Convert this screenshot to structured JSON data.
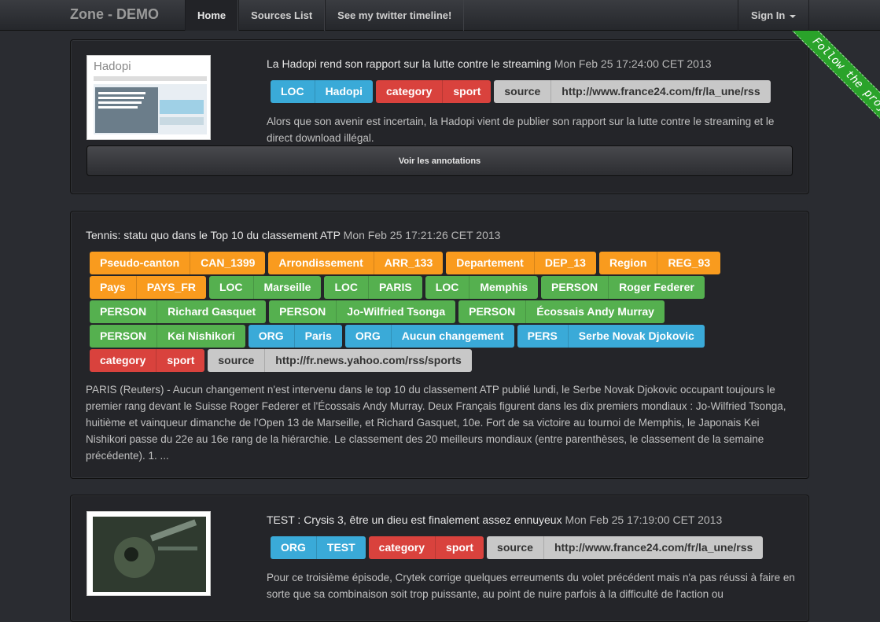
{
  "navbar": {
    "brand": "Zone - DEMO",
    "links": [
      "Home",
      "Sources List",
      "See my twitter timeline!"
    ],
    "signin": "Sign In"
  },
  "ribbon": "Follow the project",
  "articles": [
    {
      "title": "La Hadopi rend son rapport sur la lutte contre le streaming",
      "date": "Mon Feb 25 17:24:00 CET 2013",
      "thumb_caption": "Hadopi",
      "tags": [
        {
          "color": "blue",
          "k": "LOC",
          "v": "Hadopi"
        },
        {
          "color": "red",
          "k": "category",
          "v": "sport"
        },
        {
          "color": "grey",
          "k": "source",
          "v": "http://www.france24.com/fr/la_une/rss"
        }
      ],
      "desc": "Alors que son avenir est incertain, la Hadopi vient de publier son rapport sur la lutte contre le streaming et le direct download illégal.",
      "button": "Voir les annotations"
    },
    {
      "title": "Tennis: statu quo dans le Top 10 du classement ATP",
      "date": "Mon Feb 25 17:21:26 CET 2013",
      "tags": [
        {
          "color": "orange",
          "k": "Pseudo-canton",
          "v": "CAN_1399"
        },
        {
          "color": "orange",
          "k": "Arrondissement",
          "v": "ARR_133"
        },
        {
          "color": "orange",
          "k": "Departement",
          "v": "DEP_13"
        },
        {
          "color": "orange",
          "k": "Region",
          "v": "REG_93"
        },
        {
          "color": "orange",
          "k": "Pays",
          "v": "PAYS_FR"
        },
        {
          "color": "green",
          "k": "LOC",
          "v": "Marseille"
        },
        {
          "color": "green",
          "k": "LOC",
          "v": "PARIS"
        },
        {
          "color": "green",
          "k": "LOC",
          "v": "Memphis"
        },
        {
          "color": "green",
          "k": "PERSON",
          "v": "Roger Federer"
        },
        {
          "color": "green",
          "k": "PERSON",
          "v": "Richard Gasquet"
        },
        {
          "color": "green",
          "k": "PERSON",
          "v": "Jo-Wilfried Tsonga"
        },
        {
          "color": "green",
          "k": "PERSON",
          "v": "Écossais Andy Murray"
        },
        {
          "color": "green",
          "k": "PERSON",
          "v": "Kei Nishikori"
        },
        {
          "color": "blue",
          "k": "ORG",
          "v": "Paris"
        },
        {
          "color": "blue",
          "k": "ORG",
          "v": "Aucun changement"
        },
        {
          "color": "blue",
          "k": "PERS",
          "v": "Serbe Novak Djokovic"
        },
        {
          "color": "red",
          "k": "category",
          "v": "sport"
        },
        {
          "color": "grey",
          "k": "source",
          "v": "http://fr.news.yahoo.com/rss/sports"
        }
      ],
      "desc": "PARIS (Reuters) - Aucun changement n'est intervenu dans le top 10 du classement ATP publié lundi, le Serbe Novak Djokovic occupant toujours le premier rang devant le Suisse Roger Federer et l'Écossais Andy Murray. Deux Français figurent dans les dix premiers mondiaux : Jo-Wilfried Tsonga, huitième et vainqueur dimanche de l'Open 13 de Marseille, et Richard Gasquet, 10e. Fort de sa victoire au tournoi de Memphis, le Japonais Kei Nishikori passe du 22e au 16e rang de la hiérarchie. Le classement des 20 meilleurs mondiaux (entre parenthèses, le classement de la semaine précédente). 1. ..."
    },
    {
      "title": "TEST : Crysis 3, être un dieu est finalement assez ennuyeux",
      "date": "Mon Feb 25 17:19:00 CET 2013",
      "tags": [
        {
          "color": "blue",
          "k": "ORG",
          "v": "TEST"
        },
        {
          "color": "red",
          "k": "category",
          "v": "sport"
        },
        {
          "color": "grey",
          "k": "source",
          "v": "http://www.france24.com/fr/la_une/rss"
        }
      ],
      "desc": "Pour ce troisième épisode, Crytek corrige quelques erreuments du volet précédent mais n'a pas réussi à faire en sorte que sa combinaison soit trop puissante, au point de nuire parfois à la difficulté de l'action ou"
    }
  ]
}
